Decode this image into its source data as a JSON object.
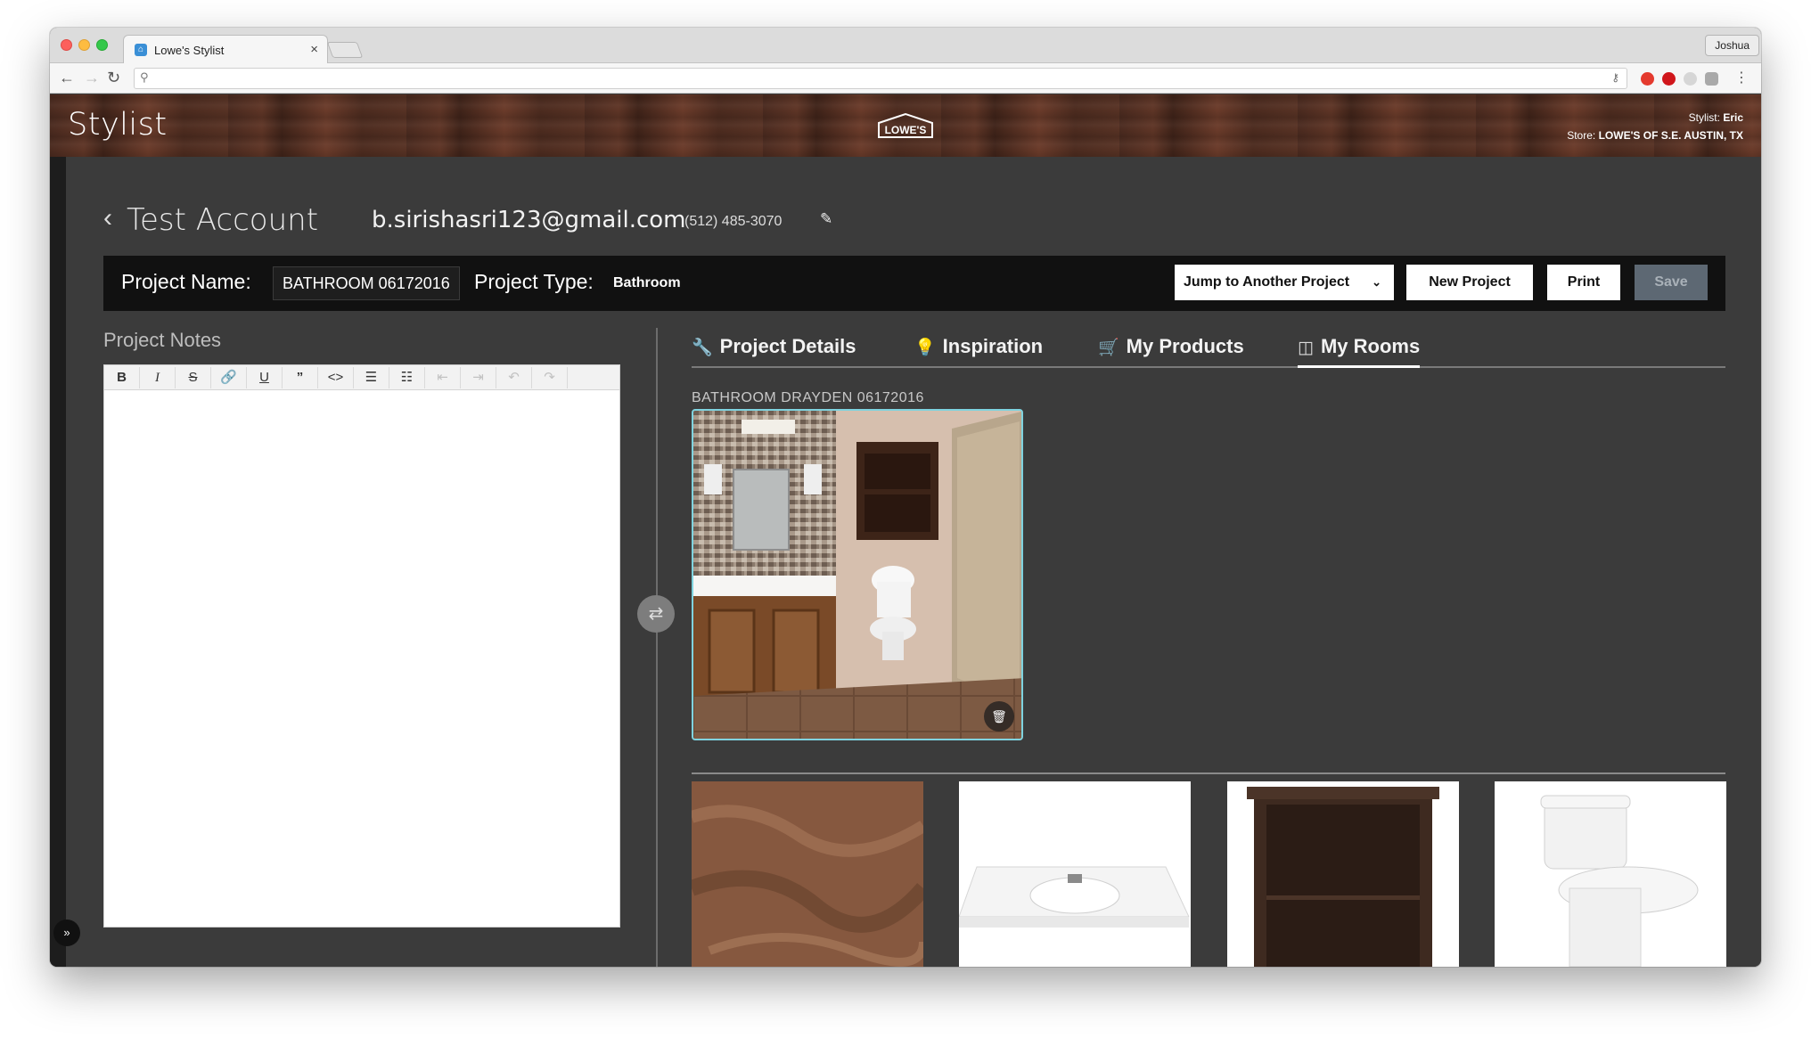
{
  "browser": {
    "tab_title": "Lowe's Stylist",
    "tab_favicon": "lowes-favicon",
    "tab_close": "×",
    "profile_name": "Joshua",
    "url": ""
  },
  "header": {
    "brand": "Stylist",
    "logo_text": "LOWE'S",
    "stylist_label": "Stylist:",
    "stylist_name": "Eric",
    "store_label": "Store:",
    "store_name": "LOWE'S OF S.E. AUSTIN, TX"
  },
  "account": {
    "name": "Test Account",
    "email": "b.sirishasri123@gmail.com",
    "phone": "(512) 485-3070"
  },
  "project": {
    "name_label": "Project Name:",
    "name_value": "BATHROOM 06172016",
    "type_label": "Project Type:",
    "type_value": "Bathroom",
    "jump_label": "Jump to Another Project",
    "new_label": "New Project",
    "print_label": "Print",
    "save_label": "Save"
  },
  "notes": {
    "title": "Project Notes",
    "toolbar": [
      "B",
      "I",
      "S",
      "link",
      "U",
      "quote",
      "code",
      "ul",
      "ol",
      "outdent",
      "indent",
      "undo",
      "redo"
    ],
    "content": ""
  },
  "tabs": [
    {
      "label": "Project Details",
      "icon": "wrench-icon"
    },
    {
      "label": "Inspiration",
      "icon": "lightbulb-icon"
    },
    {
      "label": "My Products",
      "icon": "basket-icon"
    },
    {
      "label": "My Rooms",
      "icon": "room-icon",
      "active": true
    }
  ],
  "room": {
    "label": "BATHROOM DRAYDEN 06172016"
  },
  "products": [
    {
      "name": "tile-flooring",
      "icon": "tile-image"
    },
    {
      "name": "vanity-top-sink",
      "icon": "sink-image"
    },
    {
      "name": "wall-cabinet",
      "icon": "cabinet-image"
    },
    {
      "name": "toilet",
      "icon": "toilet-image"
    }
  ],
  "colors": {
    "accent": "#7fd3df",
    "bar": "#111111",
    "bg": "#3b3b3b",
    "save_disabled": "#5d6873"
  }
}
